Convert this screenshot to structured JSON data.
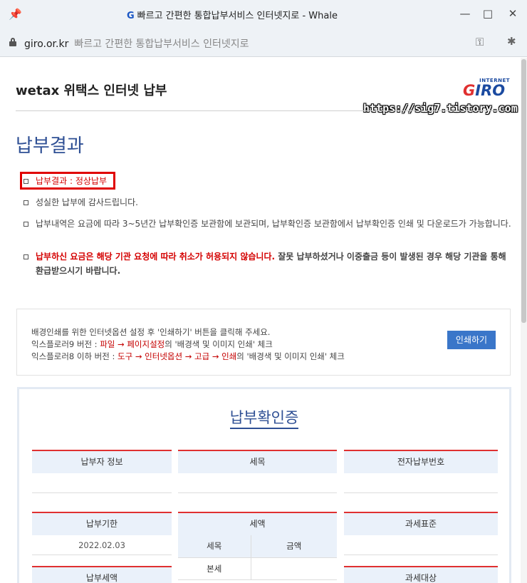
{
  "window": {
    "title_logo": "G",
    "title": "빠르고 간편한 통합납부서비스 인터넷지로 - Whale",
    "min_glyph": "—",
    "max_glyph": "□",
    "close_glyph": "✕"
  },
  "address": {
    "domain": "giro.or.kr",
    "page_name": "빠르고 간편한 통합납부서비스 인터넷지로"
  },
  "icons": {
    "pin": "pin-icon",
    "lock": "lock-icon",
    "key": "key-icon",
    "extension": "extension-icon"
  },
  "header": {
    "site_title": "wetax 위택스 인터넷 납부",
    "logo_top": "INTERNET",
    "logo_g": "G",
    "logo_rest": "IRO",
    "watermark": "https://sig7.tistory.com"
  },
  "result": {
    "heading": "납부결과",
    "status_label": "납부결과 : 정상납부",
    "thanks": "성실한 납부에 감사드립니다.",
    "storage_notice": "납부내역은 요금에 따라 3~5년간 납부확인증 보관함에 보관되며, 납부확인증 보관함에서 납부확인증 인쇄 및 다운로드가 가능합니다.",
    "cancel_warning": "납부하신 요금은 해당 기관 요청에 따라 취소가 허용되지 않습니다.",
    "refund_notice": " 잘못 납부하셨거나 이중출금 등이 발생된 경우 해당 기관을 통해 환급받으시기 바랍니다."
  },
  "print": {
    "line1": "배경인쇄를 위한 인터넷옵션 설정 후 '인쇄하기' 버튼을 클릭해 주세요.",
    "line2_prefix": "익스플로러9 버전 : ",
    "line2_path": "파일 → 페이지설정",
    "line2_suffix": "의 '배경색 및 이미지 인쇄' 체크",
    "line3_prefix": "익스플로러8 이하 버전 : ",
    "line3_path": "도구 → 인터넷옵션 → 고급 → 인쇄",
    "line3_suffix": "의 '배경색 및 이미지 인쇄' 체크",
    "button": "인쇄하기"
  },
  "certificate": {
    "title": "납부확인증",
    "payer_info": "납부자 정보",
    "tax_item": "세목",
    "e_payment_no": "전자납부번호",
    "due_date": "납부기한",
    "due_date_value": "2022.02.03",
    "tax_amount": "세액",
    "sub_item": "세목",
    "sub_amount": "금액",
    "sub_main_tax": "본세",
    "tax_standard": "과세표준",
    "payment_amount": "납부세액",
    "tax_object": "과세대상"
  }
}
